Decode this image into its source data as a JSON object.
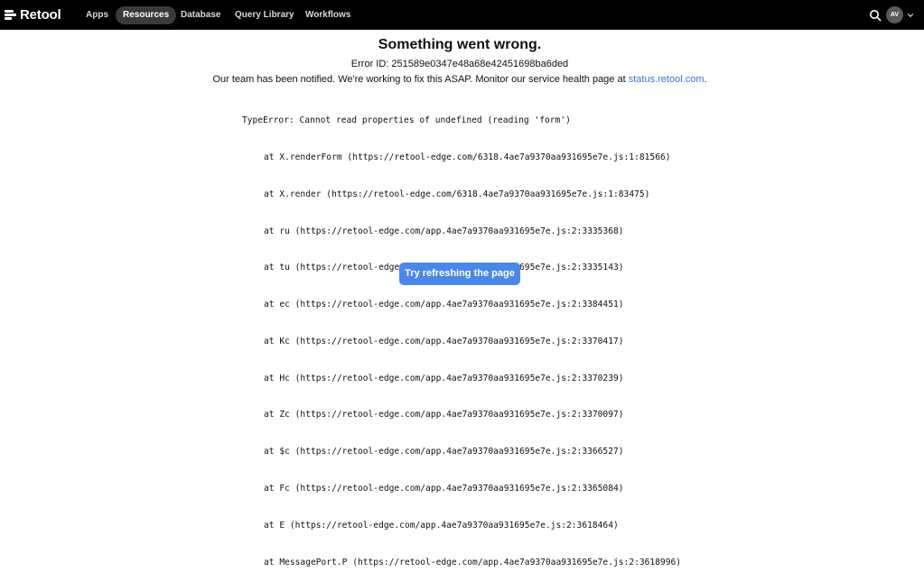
{
  "header": {
    "logo_text": "Retool",
    "nav": [
      {
        "label": "Apps",
        "active": false
      },
      {
        "label": "Resources",
        "active": true
      },
      {
        "label": "Database",
        "active": false
      },
      {
        "label": "Query Library",
        "active": false
      },
      {
        "label": "Workflows",
        "active": false
      }
    ],
    "search_icon": "search-icon",
    "avatar_initials": "AV",
    "chevron_icon": "chevron-down-icon"
  },
  "error": {
    "title": "Something went wrong.",
    "error_id": "Error ID: 251589e0347e48a68e42451698ba6ded",
    "notice_prefix": "Our team has been notified. We're working to fix this ASAP. Monitor our service health page at ",
    "status_link": "status.retool.com",
    "notice_suffix": ".",
    "trace_header": "TypeError: Cannot read properties of undefined (reading 'form')",
    "trace_frames": [
      "at X.renderForm (https://retool-edge.com/6318.4ae7a9370aa931695e7e.js:1:81566)",
      "at X.render (https://retool-edge.com/6318.4ae7a9370aa931695e7e.js:1:83475)",
      "at ru (https://retool-edge.com/app.4ae7a9370aa931695e7e.js:2:3335368)",
      "at tu (https://retool-edge.com/app.4ae7a9370aa931695e7e.js:2:3335143)",
      "at ec (https://retool-edge.com/app.4ae7a9370aa931695e7e.js:2:3384451)",
      "at Kc (https://retool-edge.com/app.4ae7a9370aa931695e7e.js:2:3370417)",
      "at Hc (https://retool-edge.com/app.4ae7a9370aa931695e7e.js:2:3370239)",
      "at Zc (https://retool-edge.com/app.4ae7a9370aa931695e7e.js:2:3370097)",
      "at $c (https://retool-edge.com/app.4ae7a9370aa931695e7e.js:2:3366527)",
      "at Fc (https://retool-edge.com/app.4ae7a9370aa931695e7e.js:2:3365084)",
      "at E (https://retool-edge.com/app.4ae7a9370aa931695e7e.js:2:3618464)",
      "at MessagePort.P (https://retool-edge.com/app.4ae7a9370aa931695e7e.js:2:3618996)"
    ],
    "refresh_button": "Try refreshing the page"
  },
  "colors": {
    "header_bg": "#000000",
    "link": "#3a74d9",
    "button_bg": "#4b87e8"
  }
}
